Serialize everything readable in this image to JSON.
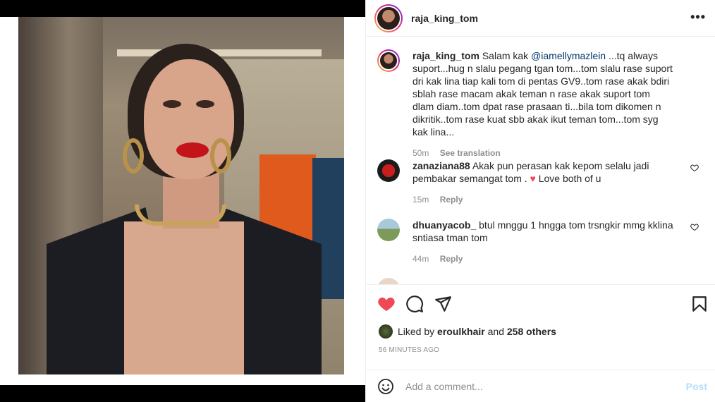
{
  "post": {
    "username": "raja_king_tom"
  },
  "caption": {
    "username": "raja_king_tom",
    "text_before": "Salam kak ",
    "mention": "@iamellymazlein",
    "text_after": " ...tq always suport...hug n slalu pegang tgan tom...tom slalu rase suport dri kak lina tiap kali tom di pentas GV9..tom rase akak bdiri sblah rase macam akak teman n rase akak suport tom dlam diam..tom dpat rase prasaan ti...bila tom dikomen n dikritik..tom rase kuat sbb akak ikut teman tom...tom syg kak lina...",
    "time": "50m",
    "translate": "See translation"
  },
  "comments": [
    {
      "username": "zanaziana88",
      "text": "Akak pun perasan kak kepom selalu jadi pembakar semangat tom . ",
      "heart": "♥",
      "text_end": " Love both of u",
      "time": "15m",
      "reply": "Reply"
    },
    {
      "username": "dhuanyacob_",
      "text": "btul mnggu 1 hngga tom trsngkir mmg kklina sntiasa tman tom",
      "time": "44m",
      "reply": "Reply"
    }
  ],
  "likes": {
    "prefix": "Liked by ",
    "liker": "eroulkhair",
    "middle": " and ",
    "others": "258 others"
  },
  "timestamp": "56 MINUTES AGO",
  "add_comment": {
    "placeholder": "Add a comment...",
    "post_label": "Post"
  },
  "icons": {
    "like": "heart-icon",
    "comment": "comment-icon",
    "share": "share-icon",
    "save": "bookmark-icon",
    "emoji": "emoji-icon",
    "more": "more-options-icon"
  },
  "colors": {
    "like_red": "#ed4956",
    "post_button": "#b2dffc",
    "mention": "#00376b",
    "meta_gray": "#8e8e8e"
  }
}
